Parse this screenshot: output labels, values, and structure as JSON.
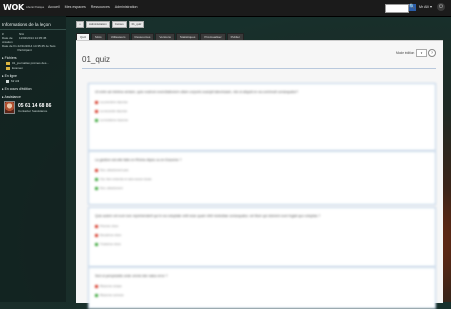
{
  "topbar": {
    "logo": "WOK",
    "logo_sub": "Liberté Pratique",
    "nav": [
      "Accueil",
      "Mes espaces",
      "Ressources",
      "Administration"
    ],
    "user": "Mr Alli",
    "user_caret": "▾",
    "search_glyph": "🔍",
    "power_glyph": "⏻"
  },
  "left": {
    "title": "Informations de la leçon",
    "info": [
      {
        "k": "#",
        "v": "N/A"
      },
      {
        "k": "Date de création",
        "v": "11/02/2014 14:35:45"
      },
      {
        "k": "Date de fin",
        "v": "22/11/2014 14:35:45 Je Suis Participant"
      }
    ],
    "folders_title": "Fichiers",
    "folders": [
      "01_journalisé prémes des...",
      "Examen"
    ],
    "online_title": "En ligne",
    "online_user": "Mr Alli",
    "progress_title": "En cours d'édition",
    "assistance_title": "Assistance",
    "phone": "05 61 14 68 86",
    "contact": "Contacter l'assistance"
  },
  "breadcrumb": [
    "Administration",
    "Cursus",
    "01_quiz"
  ],
  "breadcrumb_home": "⌂",
  "tabs": [
    "Quiz",
    "Mots",
    "Utilisateurs",
    "Ressources",
    "Versions",
    "Statistiques",
    "Prévisualiser",
    "Publier"
  ],
  "main": {
    "title": "01_quiz",
    "mode_label": "Mode édition",
    "mode_value": "▾",
    "help": "?"
  },
  "questions": [
    {
      "text": "Ut enim ad minima veniam, quis nostrum exercitationem ullam corporis suscipit laboriosam, nisi ut aliquid ex ea commodi consequatur?",
      "answers": [
        {
          "label": "La première réponse",
          "correct": false
        },
        {
          "label": "La seconde réponse",
          "correct": false
        },
        {
          "label": "La troisième réponse",
          "correct": true
        }
      ]
    },
    {
      "text": "La gestion est-elle faite en Rhône-Alpes ou en Essonne ?",
      "answers": [
        {
          "label": "Non, absolument pas",
          "correct": false
        },
        {
          "label": "Oui, bien entendu et sans aucun doute",
          "correct": true
        },
        {
          "label": "Non, absolument",
          "correct": true
        }
      ]
    },
    {
      "text": "Quis autem vel eum iure reprehenderit qui in ea voluptate velit esse quam nihil molestiae consequatur, vel illum qui dolorem eum fugiat quo voluptas ?",
      "answers": [
        {
          "label": "Premier choix",
          "correct": false
        },
        {
          "label": "Deuxième choix",
          "correct": false
        },
        {
          "label": "Troisième choix",
          "correct": true
        }
      ]
    },
    {
      "text": "Sed ut perspiciatis unde omnis iste natus error ?",
      "answers": [
        {
          "label": "Réponse unique",
          "correct": false
        },
        {
          "label": "Réponse correcte",
          "correct": true
        }
      ]
    }
  ]
}
